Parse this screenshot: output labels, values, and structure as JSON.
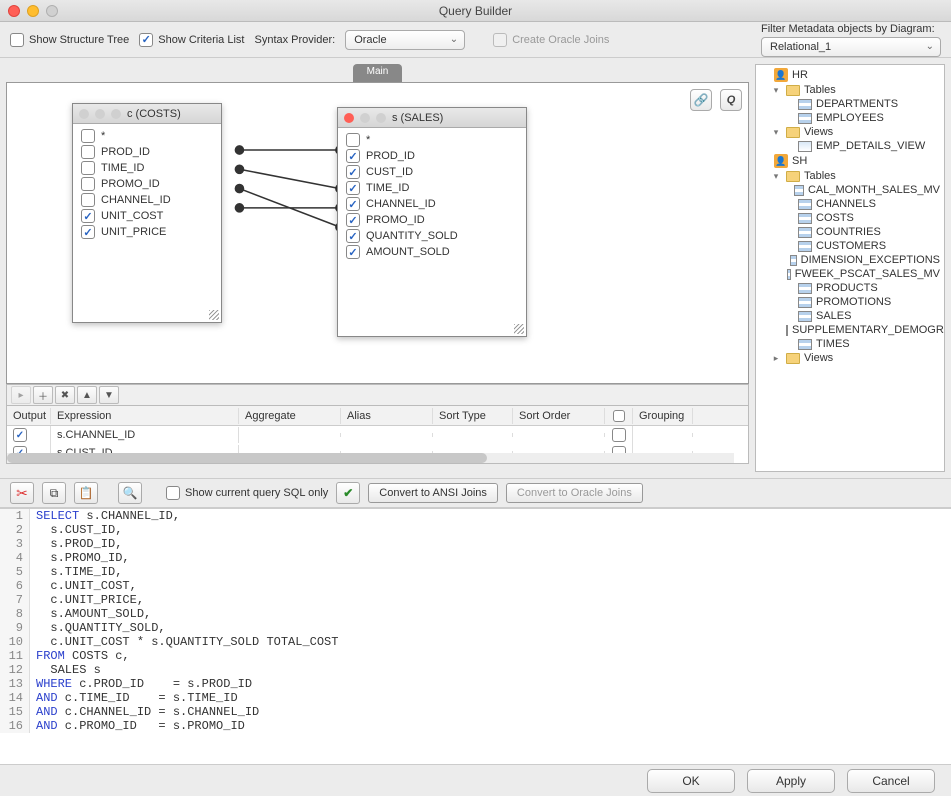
{
  "window": {
    "title": "Query Builder"
  },
  "toolbar": {
    "show_structure_tree": "Show Structure Tree",
    "show_criteria_list": "Show Criteria List",
    "syntax_label": "Syntax Provider:",
    "syntax_value": "Oracle",
    "create_oracle_joins": "Create Oracle Joins",
    "filter_label": "Filter Metadata objects by Diagram:",
    "filter_value": "Relational_1"
  },
  "tab": {
    "main": "Main"
  },
  "canvas": {
    "q_button": "Q",
    "tables": {
      "costs": {
        "title": "c (COSTS)",
        "fields": [
          {
            "name": "*",
            "checked": false
          },
          {
            "name": "PROD_ID",
            "checked": false
          },
          {
            "name": "TIME_ID",
            "checked": false
          },
          {
            "name": "PROMO_ID",
            "checked": false
          },
          {
            "name": "CHANNEL_ID",
            "checked": false
          },
          {
            "name": "UNIT_COST",
            "checked": true
          },
          {
            "name": "UNIT_PRICE",
            "checked": true
          }
        ]
      },
      "sales": {
        "title": "s (SALES)",
        "fields": [
          {
            "name": "*",
            "checked": false
          },
          {
            "name": "PROD_ID",
            "checked": true
          },
          {
            "name": "CUST_ID",
            "checked": true
          },
          {
            "name": "TIME_ID",
            "checked": true
          },
          {
            "name": "CHANNEL_ID",
            "checked": true
          },
          {
            "name": "PROMO_ID",
            "checked": true
          },
          {
            "name": "QUANTITY_SOLD",
            "checked": true
          },
          {
            "name": "AMOUNT_SOLD",
            "checked": true
          }
        ]
      }
    },
    "joins": [
      {
        "from": "costs.PROD_ID",
        "to": "sales.PROD_ID"
      },
      {
        "from": "costs.TIME_ID",
        "to": "sales.TIME_ID"
      },
      {
        "from": "costs.PROMO_ID",
        "to": "sales.PROMO_ID"
      },
      {
        "from": "costs.CHANNEL_ID",
        "to": "sales.CHANNEL_ID"
      }
    ]
  },
  "grid": {
    "headers": {
      "output": "Output",
      "expression": "Expression",
      "aggregate": "Aggregate",
      "alias": "Alias",
      "sort_type": "Sort Type",
      "sort_order": "Sort Order",
      "grouping": "Grouping"
    },
    "rows": [
      {
        "output": true,
        "expression": "s.CHANNEL_ID",
        "grouping": false
      },
      {
        "output": true,
        "expression": "s.CUST_ID",
        "grouping": false
      }
    ]
  },
  "midbar": {
    "show_current_sql": "Show current query SQL only",
    "convert_ansi": "Convert to ANSI Joins",
    "convert_oracle": "Convert to Oracle Joins"
  },
  "sql": [
    {
      "n": "1",
      "html": "<span class=\"kw\">SELECT</span> s.CHANNEL_ID,"
    },
    {
      "n": "2",
      "html": "  s.CUST_ID,"
    },
    {
      "n": "3",
      "html": "  s.PROD_ID,"
    },
    {
      "n": "4",
      "html": "  s.PROMO_ID,"
    },
    {
      "n": "5",
      "html": "  s.TIME_ID,"
    },
    {
      "n": "6",
      "html": "  c.UNIT_COST,"
    },
    {
      "n": "7",
      "html": "  c.UNIT_PRICE,"
    },
    {
      "n": "8",
      "html": "  s.AMOUNT_SOLD,"
    },
    {
      "n": "9",
      "html": "  s.QUANTITY_SOLD,"
    },
    {
      "n": "10",
      "html": "  c.UNIT_COST * s.QUANTITY_SOLD TOTAL_COST"
    },
    {
      "n": "11",
      "html": "<span class=\"kw\">FROM</span> COSTS c,"
    },
    {
      "n": "12",
      "html": "  SALES s"
    },
    {
      "n": "13",
      "html": "<span class=\"kw\">WHERE</span> c.PROD_ID    = s.PROD_ID"
    },
    {
      "n": "14",
      "html": "<span class=\"kw\">AND</span> c.TIME_ID    = s.TIME_ID"
    },
    {
      "n": "15",
      "html": "<span class=\"kw\">AND</span> c.CHANNEL_ID = s.CHANNEL_ID"
    },
    {
      "n": "16",
      "html": "<span class=\"kw\">AND</span> c.PROMO_ID   = s.PROMO_ID"
    }
  ],
  "tree": [
    {
      "lvl": 0,
      "tw": "",
      "icon": "schema",
      "label": "HR"
    },
    {
      "lvl": 1,
      "tw": "▾",
      "icon": "folder",
      "label": "Tables"
    },
    {
      "lvl": 2,
      "tw": "",
      "icon": "table",
      "label": "DEPARTMENTS"
    },
    {
      "lvl": 2,
      "tw": "",
      "icon": "table",
      "label": "EMPLOYEES"
    },
    {
      "lvl": 1,
      "tw": "▾",
      "icon": "folder",
      "label": "Views"
    },
    {
      "lvl": 2,
      "tw": "",
      "icon": "view",
      "label": "EMP_DETAILS_VIEW"
    },
    {
      "lvl": 0,
      "tw": "",
      "icon": "schema",
      "label": "SH"
    },
    {
      "lvl": 1,
      "tw": "▾",
      "icon": "folder",
      "label": "Tables"
    },
    {
      "lvl": 2,
      "tw": "",
      "icon": "table",
      "label": "CAL_MONTH_SALES_MV"
    },
    {
      "lvl": 2,
      "tw": "",
      "icon": "table",
      "label": "CHANNELS"
    },
    {
      "lvl": 2,
      "tw": "",
      "icon": "table",
      "label": "COSTS"
    },
    {
      "lvl": 2,
      "tw": "",
      "icon": "table",
      "label": "COUNTRIES"
    },
    {
      "lvl": 2,
      "tw": "",
      "icon": "table",
      "label": "CUSTOMERS"
    },
    {
      "lvl": 2,
      "tw": "",
      "icon": "table",
      "label": "DIMENSION_EXCEPTIONS"
    },
    {
      "lvl": 2,
      "tw": "",
      "icon": "table",
      "label": "FWEEK_PSCAT_SALES_MV"
    },
    {
      "lvl": 2,
      "tw": "",
      "icon": "table",
      "label": "PRODUCTS"
    },
    {
      "lvl": 2,
      "tw": "",
      "icon": "table",
      "label": "PROMOTIONS"
    },
    {
      "lvl": 2,
      "tw": "",
      "icon": "table",
      "label": "SALES"
    },
    {
      "lvl": 2,
      "tw": "",
      "icon": "table",
      "label": "SUPPLEMENTARY_DEMOGRAPHICS"
    },
    {
      "lvl": 2,
      "tw": "",
      "icon": "table",
      "label": "TIMES"
    },
    {
      "lvl": 1,
      "tw": "▸",
      "icon": "folder",
      "label": "Views"
    }
  ],
  "buttons": {
    "ok": "OK",
    "apply": "Apply",
    "cancel": "Cancel"
  }
}
